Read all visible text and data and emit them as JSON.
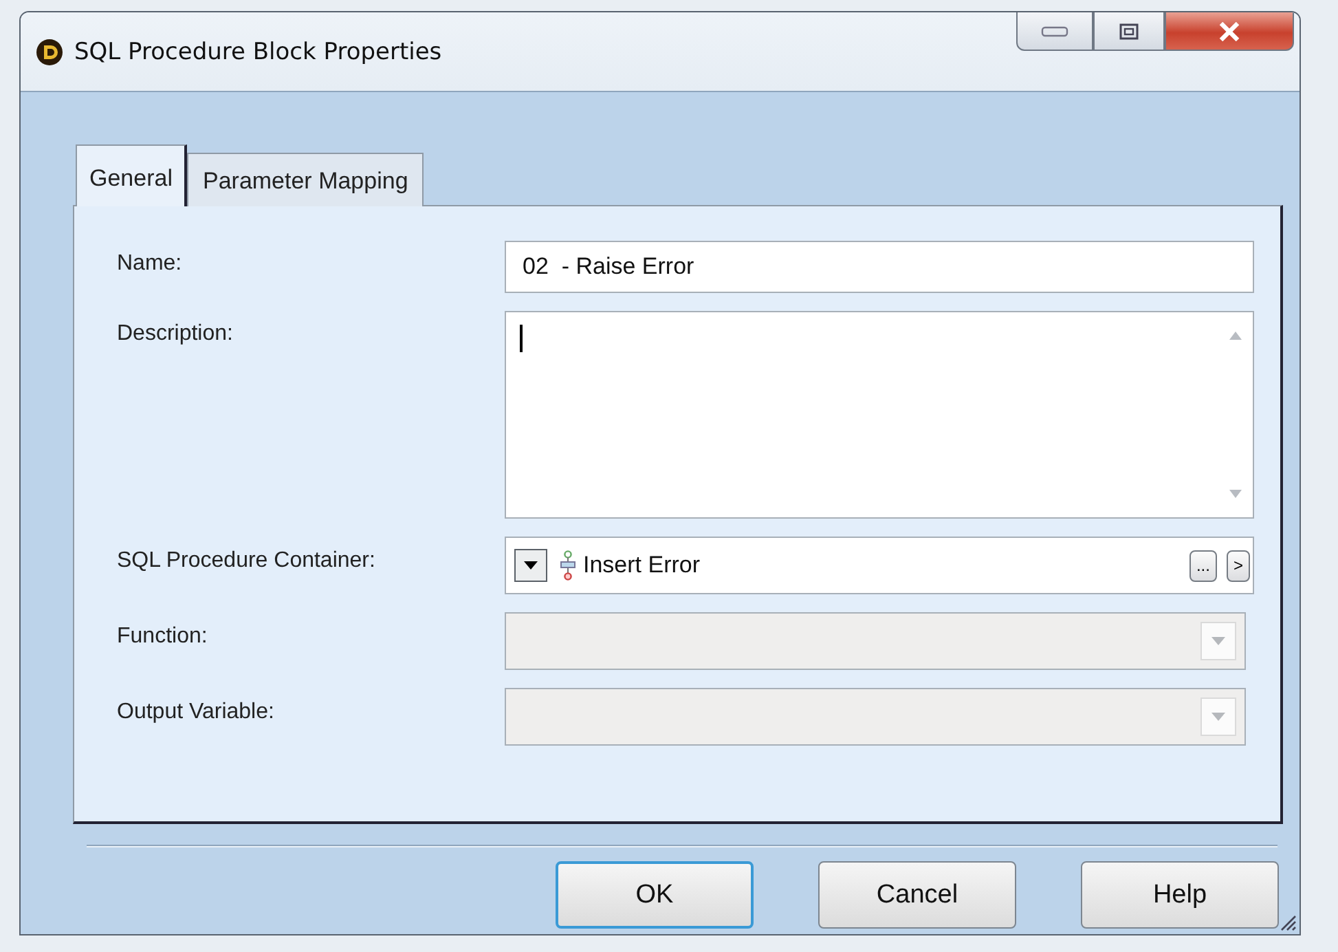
{
  "window": {
    "title": "SQL Procedure Block Properties"
  },
  "tabs": [
    {
      "label": "General",
      "selected": true
    },
    {
      "label": "Parameter Mapping",
      "selected": false
    }
  ],
  "fields": [
    {
      "kind": "text",
      "label": "Name:",
      "value": "02  - Raise Error",
      "disabled": false
    },
    {
      "kind": "textarea",
      "label": "Description:",
      "disabled": false
    },
    {
      "kind": "picker",
      "label": "SQL Procedure Container:",
      "value": "Insert Error",
      "browse": "...",
      "go": ">",
      "disabled": false
    },
    {
      "kind": "combo",
      "label": "Function:",
      "disabled": true
    },
    {
      "kind": "combo",
      "label": "Output Variable:",
      "disabled": true
    }
  ],
  "buttons": [
    {
      "label": "OK",
      "default": true
    },
    {
      "label": "Cancel",
      "default": false
    },
    {
      "label": "Help",
      "default": false
    }
  ]
}
